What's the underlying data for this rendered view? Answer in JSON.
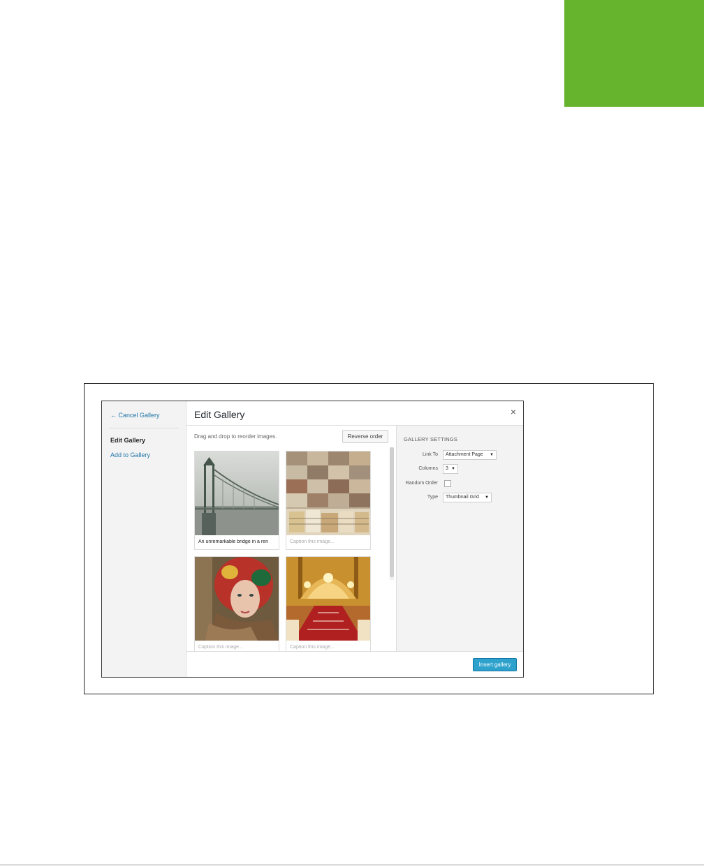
{
  "sidebar": {
    "cancel_label": "← Cancel Gallery",
    "edit_label": "Edit Gallery",
    "add_label": "Add to Gallery"
  },
  "header": {
    "title": "Edit Gallery",
    "close_label": "×"
  },
  "toolbar": {
    "instructions": "Drag and drop to reorder images.",
    "reverse_label": "Reverse order"
  },
  "images": [
    {
      "caption": "An unremarkable bridge in a ren",
      "subject": "foggy bridge"
    },
    {
      "caption": "Caption this image...",
      "subject": "city rooftops"
    },
    {
      "caption": "Caption this image...",
      "subject": "woman in headscarf"
    },
    {
      "caption": "Caption this image...",
      "subject": "ornate hall staircase"
    }
  ],
  "settings": {
    "heading": "GALLERY SETTINGS",
    "link_to_label": "Link To",
    "link_to_value": "Attachment Page",
    "columns_label": "Columns",
    "columns_value": "3",
    "random_label": "Random Order",
    "type_label": "Type",
    "type_value": "Thumbnail Grid",
    "dropdown_arrow": "▼"
  },
  "footer": {
    "insert_label": "Insert gallery"
  },
  "colors": {
    "accent": "#66b32e",
    "link": "#2277aa",
    "primary_button": "#2ea2cc"
  }
}
